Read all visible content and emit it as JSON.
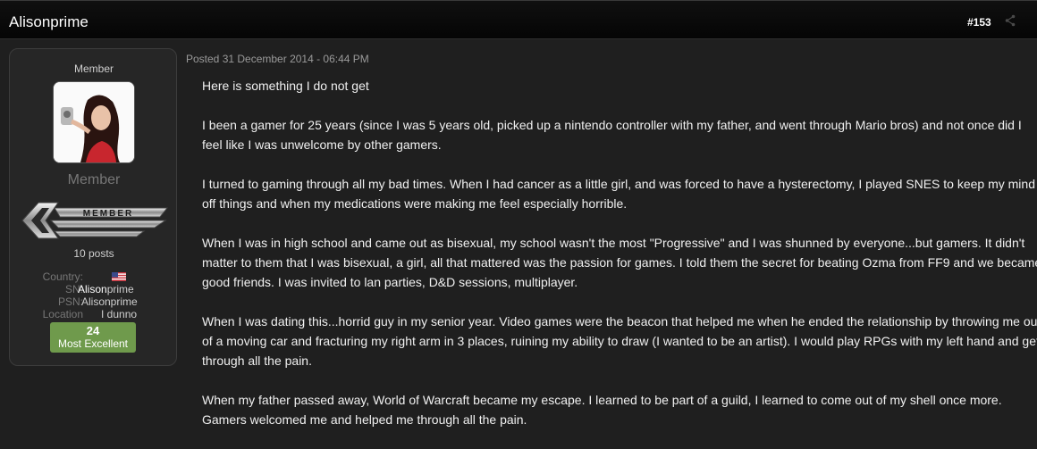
{
  "header": {
    "title": "Alisonprime",
    "post_number": "#153",
    "share_icon": "share-icon"
  },
  "author": {
    "role_top": "Member",
    "role_title": "Member",
    "badge_text": "MEMBER",
    "post_count": "10 posts",
    "fields": {
      "country_label": "Country:",
      "sn_label": "SN:",
      "sn_value_bold": "Alison",
      "sn_value_rest": "prime",
      "psn_label": "PSN:",
      "psn_value": "Alisonprime",
      "location_label": "Location",
      "location_value": "I dunno"
    },
    "reputation": {
      "value": "24",
      "label": "Most Excellent",
      "color": "#6f9a4c"
    }
  },
  "post": {
    "posted": "Posted 31 December 2014 - 06:44 PM",
    "paragraphs": [
      "Here is something I do not get",
      "I been a gamer for 25 years (since I was 5 years old, picked up a nintendo controller with my father, and went through Mario bros) and not once did I feel like I was unwelcome by other gamers.",
      "I turned to gaming through all my bad times. When I had cancer as a little girl, and was forced to have a hysterectomy, I played SNES to keep my mind off things and when my medications were making me feel especially horrible.",
      "When I was in high school and came out as bisexual, my school wasn't the most \"Progressive\" and I was shunned by everyone...but gamers. It didn't matter to them that I was bisexual, a girl, all that mattered was the passion for games. I told them the secret for beating Ozma from FF9 and we became good friends. I was invited to lan parties, D&D sessions, multiplayer.",
      "When I was dating this...horrid guy in my senior year. Video games were the beacon that helped me when he ended the relationship by throwing me out of a moving car and fracturing my right arm in 3 places, ruining my ability to draw (I wanted to be an artist). I would play RPGs with my left hand and get through all the pain.",
      "When my father passed away, World of Warcraft became my escape. I learned to be part of a guild, I learned to come out of my shell once more. Gamers welcomed me and helped me through all the pain."
    ]
  }
}
